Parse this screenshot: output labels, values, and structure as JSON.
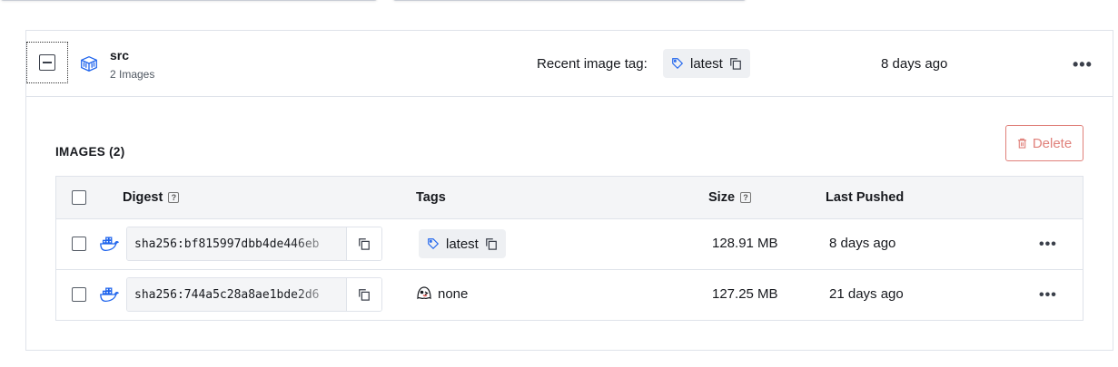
{
  "repository": {
    "name": "src",
    "image_count_label": "2 Images",
    "recent_tag_label": "Recent image tag:",
    "recent_tag": "latest",
    "last_pushed": "8 days ago"
  },
  "images_section": {
    "title": "IMAGES (2)",
    "delete_label": "Delete",
    "columns": {
      "digest": "Digest",
      "tags": "Tags",
      "size": "Size",
      "last_pushed": "Last Pushed"
    },
    "rows": [
      {
        "digest": "sha256:bf815997dbb4de446eb",
        "tag": "latest",
        "size": "128.91 MB",
        "last_pushed": "8 days ago"
      },
      {
        "digest": "sha256:744a5c28a8ae1bde2d6",
        "tag": "none",
        "size": "127.25 MB",
        "last_pushed": "21 days ago"
      }
    ]
  },
  "colors": {
    "accent_delete": "#e0807a",
    "docker_blue": "#1d63ed",
    "border": "#dfe3ea",
    "chip_bg": "#eef0f3"
  },
  "icons": {
    "repo": "package-icon",
    "tag": "tag-icon",
    "copy": "copy-icon",
    "docker": "docker-whale-icon",
    "none_tag": "ghost-icon",
    "trash": "trash-icon",
    "more": "more-horizontal-icon"
  }
}
